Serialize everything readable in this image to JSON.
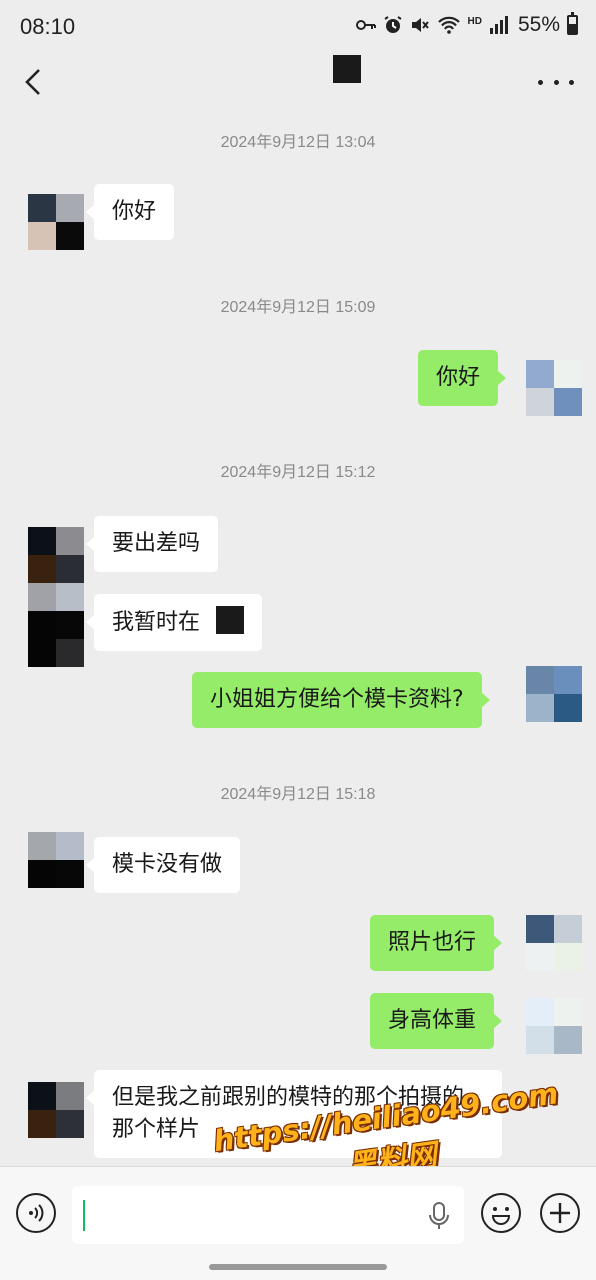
{
  "status_bar": {
    "time": "08:10",
    "network": "HD",
    "battery_percent": "55%",
    "battery_level": 0.55
  },
  "header": {
    "more_label": "…"
  },
  "messages": {
    "ts1": "2024年9月12日 13:04",
    "m1": "你好",
    "ts2": "2024年9月12日 15:09",
    "m2": "你好",
    "ts3": "2024年9月12日 15:12",
    "m3": "要出差吗",
    "m4": "我暂时在",
    "m5": "小姐姐方便给个模卡资料?",
    "ts4": "2024年9月12日 15:18",
    "m6": "模卡没有做",
    "m7": "照片也行",
    "m8": "身高体重",
    "m9": "但是我之前跟别的模特的那个拍摄的那个样片"
  },
  "watermark": {
    "url": "https://heiliao49.com",
    "name": "黑料网"
  },
  "colors": {
    "background": "#ededed",
    "outgoing_bubble": "#95ec69",
    "incoming_bubble": "#ffffff",
    "caret": "#07c160",
    "watermark": "#ffb21a"
  },
  "icons": [
    "wifi-icon",
    "signal-icon",
    "battery-icon",
    "key-icon",
    "alarm-icon",
    "mute-icon",
    "back-icon",
    "more-icon",
    "voice-icon",
    "mic-icon",
    "emoji-icon",
    "plus-icon"
  ]
}
